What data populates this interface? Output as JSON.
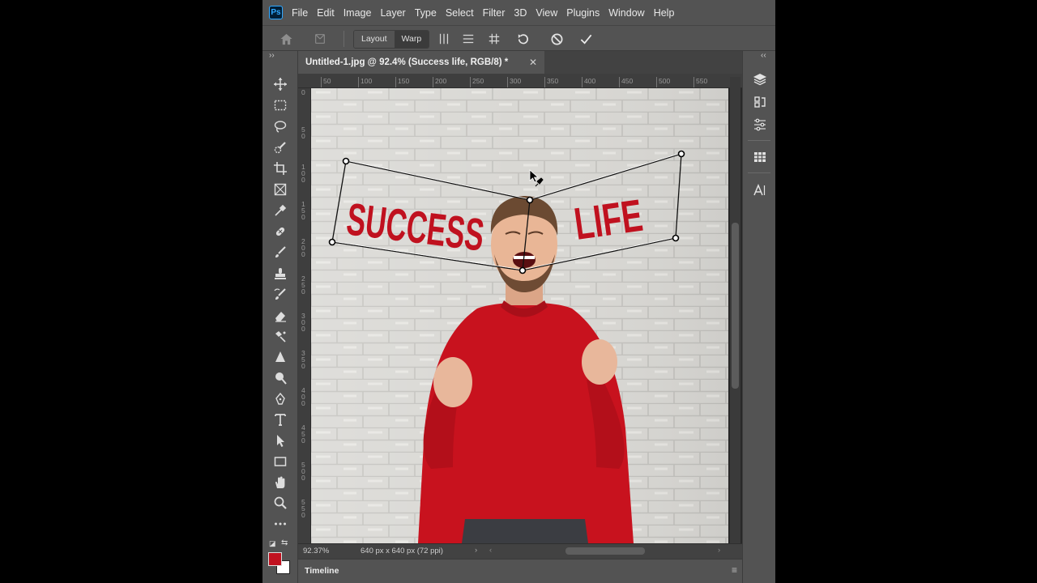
{
  "app": {
    "logo_text": "Ps"
  },
  "menu": [
    "File",
    "Edit",
    "Image",
    "Layer",
    "Type",
    "Select",
    "Filter",
    "3D",
    "View",
    "Plugins",
    "Window",
    "Help"
  ],
  "options": {
    "layout_label": "Layout",
    "warp_label": "Warp",
    "active_mode": "Warp"
  },
  "document": {
    "tab_title": "Untitled-1.jpg @ 92.4% (Success        life, RGB/8) *",
    "close_glyph": "✕",
    "canvas_text_left": "SUCCESS",
    "canvas_text_right": "LIFE"
  },
  "ruler": {
    "top_labels": [
      "50",
      "100",
      "150",
      "200",
      "250",
      "300",
      "350",
      "400",
      "450",
      "500",
      "550"
    ],
    "left_labels": [
      "0",
      "5 0",
      "1 0 0",
      "1 5 0",
      "2 0 0",
      "2 5 0",
      "3 0 0",
      "3 5 0",
      "4 0 0",
      "4 5 0",
      "5 0 0",
      "5 5 0"
    ]
  },
  "status": {
    "zoom": "92.37%",
    "doc_info": "640 px x 640 px (72 ppi)"
  },
  "timeline": {
    "label": "Timeline"
  },
  "colors": {
    "foreground": "#c0111f",
    "background": "#ffffff",
    "accent": "#31a8ff"
  },
  "left_tools": [
    "move-icon",
    "marquee-icon",
    "lasso-icon",
    "quick-select-icon",
    "crop-icon",
    "frame-icon",
    "eyedropper-icon",
    "healing-brush-icon",
    "brush-icon",
    "clone-stamp-icon",
    "history-brush-icon",
    "eraser-icon",
    "gradient-icon",
    "blur-icon",
    "dodge-icon",
    "pen-icon",
    "type-icon",
    "path-select-icon",
    "rectangle-icon",
    "hand-icon",
    "zoom-icon",
    "more-tools-icon"
  ],
  "right_panel_icons": [
    "layers-icon",
    "history-icon",
    "adjustments-icon",
    "properties-icon",
    "character-icon"
  ]
}
